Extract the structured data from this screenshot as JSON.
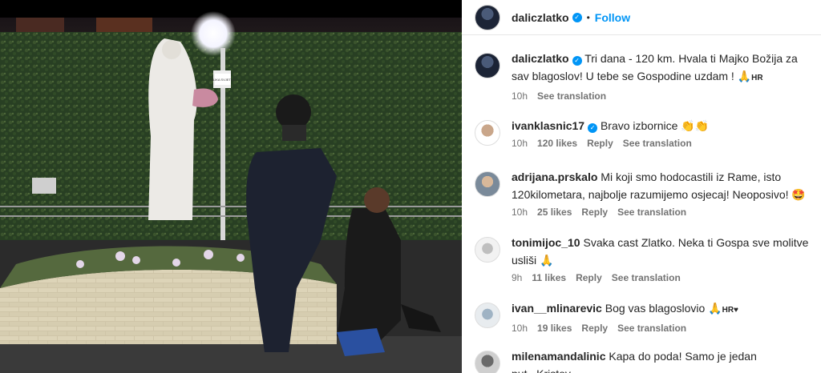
{
  "post": {
    "author": "daliczlatko",
    "follow_label": "Follow",
    "dot": "•",
    "photo_sign_text": "SLIKA SVJETLA"
  },
  "caption": {
    "user": "daliczlatko",
    "text": "Tri dana - 120 km. Hvala ti Majko Božija za sav blagoslov! U tebe se Gospodine uzdam ! 🙏",
    "lang": "HR",
    "time": "10h",
    "see_translation": "See translation"
  },
  "comments": [
    {
      "user": "ivanklasnic17",
      "verified": true,
      "text": "Bravo izbornice 👏👏",
      "time": "10h",
      "likes": "120 likes",
      "reply": "Reply",
      "see_translation": "See translation"
    },
    {
      "user": "adrijana.prskalo",
      "verified": false,
      "text": "Mi koji smo hodocastili iz Rame, isto 120kilometara, najbolje razumijemo osjecaj! Neoposivo! 🤩",
      "time": "10h",
      "likes": "25 likes",
      "reply": "Reply",
      "see_translation": "See translation"
    },
    {
      "user": "tonimijoc_10",
      "verified": false,
      "text": "Svaka cast Zlatko. Neka ti Gospa sve molitve usliši 🙏",
      "time": "9h",
      "likes": "11 likes",
      "reply": "Reply",
      "see_translation": "See translation"
    },
    {
      "user": "ivan__mlinarevic",
      "verified": false,
      "text": "Bog vas blagoslovio 🙏",
      "lang": "HR♥",
      "time": "10h",
      "likes": "19 likes",
      "reply": "Reply",
      "see_translation": "See translation"
    },
    {
      "user": "milenamandalinic",
      "verified": false,
      "text": "Kapa do poda! Samo je jedan put...Kristov",
      "time": "",
      "likes": "",
      "reply": "",
      "see_translation": ""
    }
  ],
  "colors": {
    "link": "#0095f6",
    "text": "#262626",
    "muted": "#737373"
  },
  "icons": {
    "verified": "verified-badge-icon",
    "pray": "praying-hands-icon",
    "clap": "clapping-hands-icon"
  }
}
